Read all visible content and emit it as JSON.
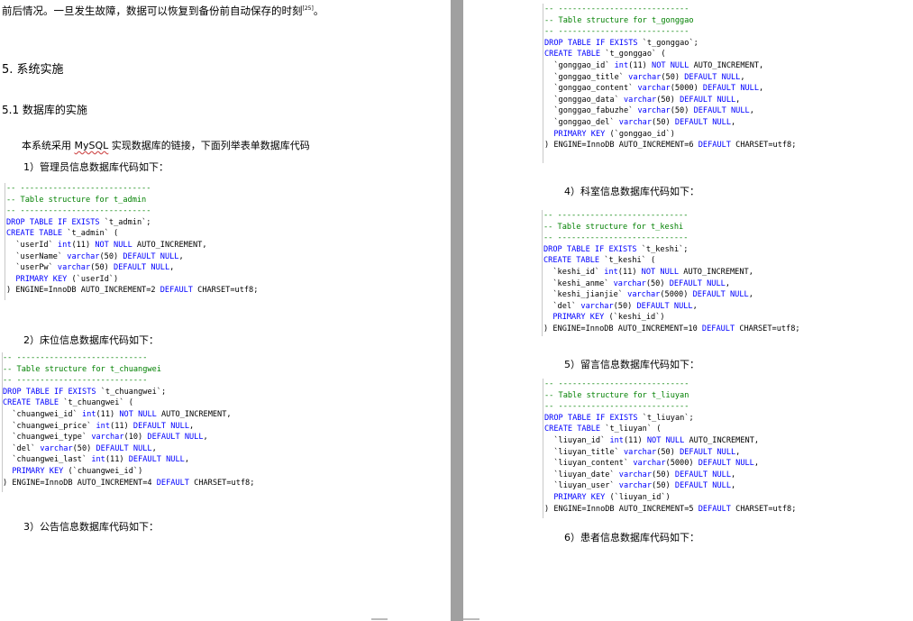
{
  "left_page": {
    "intro_line": "前后情况。一旦发生故障，数据可以恢复到备份前自动保存的时刻",
    "intro_ref": "[25]",
    "intro_end": "。",
    "section5": "5. 系统实施",
    "section51": "5.1 数据库的实施",
    "para_prefix": "本系统采用 ",
    "para_mysql": "MySQL",
    "para_suffix": " 实现数据库的链接，下面列举表单数据库代码",
    "item1": "1）管理员信息数据库代码如下：",
    "item2": "2）床位信息数据库代码如下：",
    "item3": "3）公告信息数据库代码如下："
  },
  "right_page": {
    "item4": "4）科室信息数据库代码如下：",
    "item5": "5）留言信息数据库代码如下：",
    "item6": "6）患者信息数据库代码如下："
  },
  "code_blocks": {
    "admin": [
      "-- ----------------------------",
      "-- Table structure for t_admin",
      "-- ----------------------------",
      "DROP TABLE IF EXISTS `t_admin`;",
      "CREATE TABLE `t_admin` (",
      "  `userId` int(11) NOT NULL AUTO_INCREMENT,",
      "  `userName` varchar(50) DEFAULT NULL,",
      "  `userPw` varchar(50) DEFAULT NULL,",
      "  PRIMARY KEY (`userId`)",
      ") ENGINE=InnoDB AUTO_INCREMENT=2 DEFAULT CHARSET=utf8;"
    ],
    "chuangwei": [
      "-- ----------------------------",
      "-- Table structure for t_chuangwei",
      "-- ----------------------------",
      "DROP TABLE IF EXISTS `t_chuangwei`;",
      "CREATE TABLE `t_chuangwei` (",
      "  `chuangwei_id` int(11) NOT NULL AUTO_INCREMENT,",
      "  `chuangwei_price` int(11) DEFAULT NULL,",
      "  `chuangwei_type` varchar(10) DEFAULT NULL,",
      "  `del` varchar(50) DEFAULT NULL,",
      "  `chuangwei_last` int(11) DEFAULT NULL,",
      "  PRIMARY KEY (`chuangwei_id`)",
      ") ENGINE=InnoDB AUTO_INCREMENT=4 DEFAULT CHARSET=utf8;"
    ],
    "gonggao": [
      "-- ----------------------------",
      "-- Table structure for t_gonggao",
      "-- ----------------------------",
      "DROP TABLE IF EXISTS `t_gonggao`;",
      "CREATE TABLE `t_gonggao` (",
      "  `gonggao_id` int(11) NOT NULL AUTO_INCREMENT,",
      "  `gonggao_title` varchar(50) DEFAULT NULL,",
      "  `gonggao_content` varchar(5000) DEFAULT NULL,",
      "  `gonggao_data` varchar(50) DEFAULT NULL,",
      "  `gonggao_fabuzhe` varchar(50) DEFAULT NULL,",
      "  `gonggao_del` varchar(50) DEFAULT NULL,",
      "  PRIMARY KEY (`gonggao_id`)",
      ") ENGINE=InnoDB AUTO_INCREMENT=6 DEFAULT CHARSET=utf8;"
    ],
    "keshi": [
      "-- ----------------------------",
      "-- Table structure for t_keshi",
      "-- ----------------------------",
      "DROP TABLE IF EXISTS `t_keshi`;",
      "CREATE TABLE `t_keshi` (",
      "  `keshi_id` int(11) NOT NULL AUTO_INCREMENT,",
      "  `keshi_anme` varchar(50) DEFAULT NULL,",
      "  `keshi_jianjie` varchar(5000) DEFAULT NULL,",
      "  `del` varchar(50) DEFAULT NULL,",
      "  PRIMARY KEY (`keshi_id`)",
      ") ENGINE=InnoDB AUTO_INCREMENT=10 DEFAULT CHARSET=utf8;"
    ],
    "liuyan": [
      "-- ----------------------------",
      "-- Table structure for t_liuyan",
      "-- ----------------------------",
      "DROP TABLE IF EXISTS `t_liuyan`;",
      "CREATE TABLE `t_liuyan` (",
      "  `liuyan_id` int(11) NOT NULL AUTO_INCREMENT,",
      "  `liuyan_title` varchar(50) DEFAULT NULL,",
      "  `liuyan_content` varchar(5000) DEFAULT NULL,",
      "  `liuyan_date` varchar(50) DEFAULT NULL,",
      "  `liuyan_user` varchar(50) DEFAULT NULL,",
      "  PRIMARY KEY (`liuyan_id`)",
      ") ENGINE=InnoDB AUTO_INCREMENT=5 DEFAULT CHARSET=utf8;"
    ]
  },
  "colors": {
    "comment": "#008000",
    "keyword": "#0000ff",
    "text": "#000000",
    "gutter": "#a0a0a0"
  }
}
